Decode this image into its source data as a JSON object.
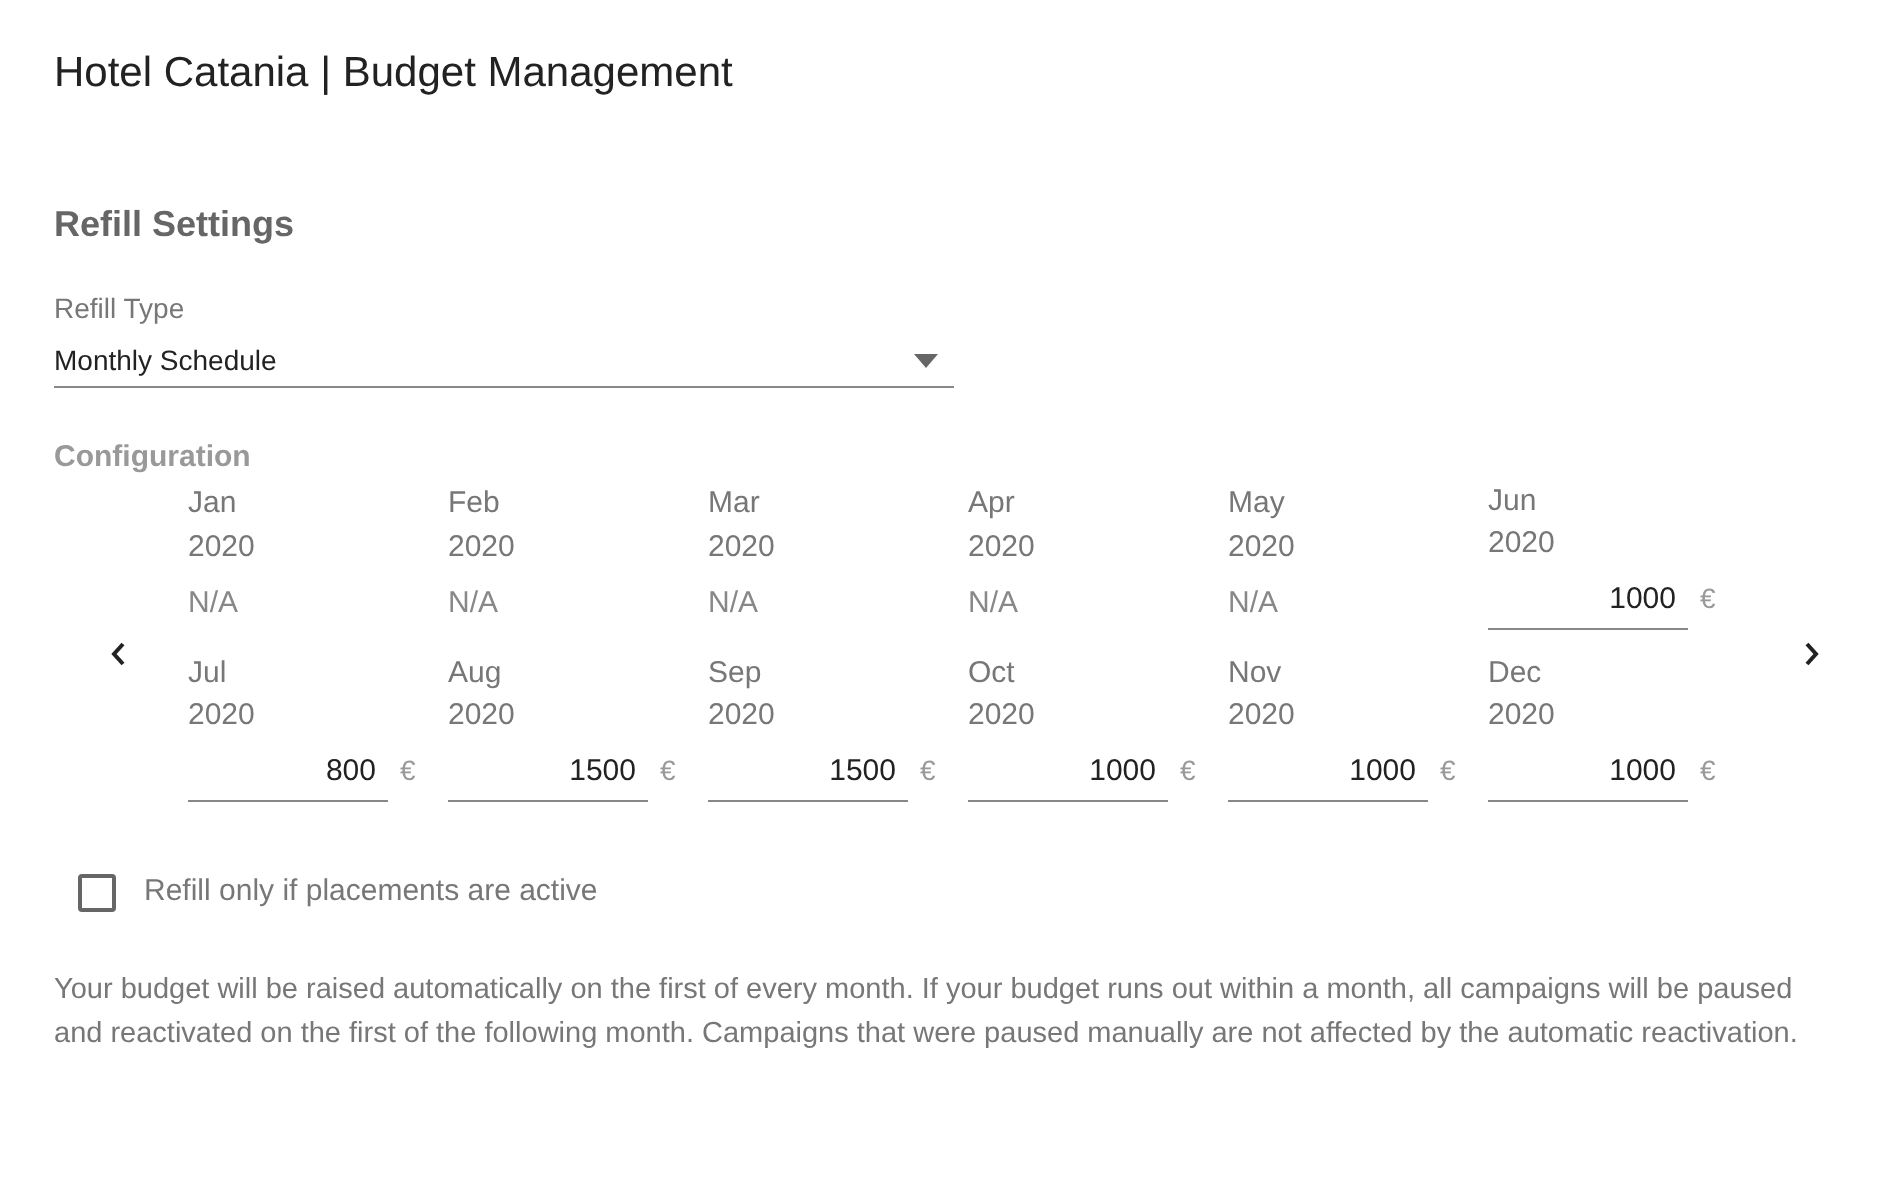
{
  "title": "Hotel Catania | Budget Management",
  "section_title": "Refill Settings",
  "refill_type": {
    "label": "Refill Type",
    "value": "Monthly Schedule"
  },
  "configuration": {
    "title": "Configuration",
    "months": [
      {
        "month": "Jan",
        "year": "2020",
        "kind": "na",
        "value": "N/A"
      },
      {
        "month": "Feb",
        "year": "2020",
        "kind": "na",
        "value": "N/A"
      },
      {
        "month": "Mar",
        "year": "2020",
        "kind": "na",
        "value": "N/A"
      },
      {
        "month": "Apr",
        "year": "2020",
        "kind": "na",
        "value": "N/A"
      },
      {
        "month": "May",
        "year": "2020",
        "kind": "na",
        "value": "N/A"
      },
      {
        "month": "Jun",
        "year": "2020",
        "kind": "input",
        "value": "1000",
        "currency": "€"
      },
      {
        "month": "Jul",
        "year": "2020",
        "kind": "input",
        "value": "800",
        "currency": "€"
      },
      {
        "month": "Aug",
        "year": "2020",
        "kind": "input",
        "value": "1500",
        "currency": "€"
      },
      {
        "month": "Sep",
        "year": "2020",
        "kind": "input",
        "value": "1500",
        "currency": "€"
      },
      {
        "month": "Oct",
        "year": "2020",
        "kind": "input",
        "value": "1000",
        "currency": "€"
      },
      {
        "month": "Nov",
        "year": "2020",
        "kind": "input",
        "value": "1000",
        "currency": "€"
      },
      {
        "month": "Dec",
        "year": "2020",
        "kind": "input",
        "value": "1000",
        "currency": "€"
      }
    ]
  },
  "refill_if_active": {
    "label": "Refill only if placements are active",
    "checked": false
  },
  "description": "Your budget will be raised automatically on the first of every month. If your budget runs out within a month, all campaigns will be paused and reactivated on the first of the following month. Campaigns that were paused manually are not affected by the automatic reactivation."
}
